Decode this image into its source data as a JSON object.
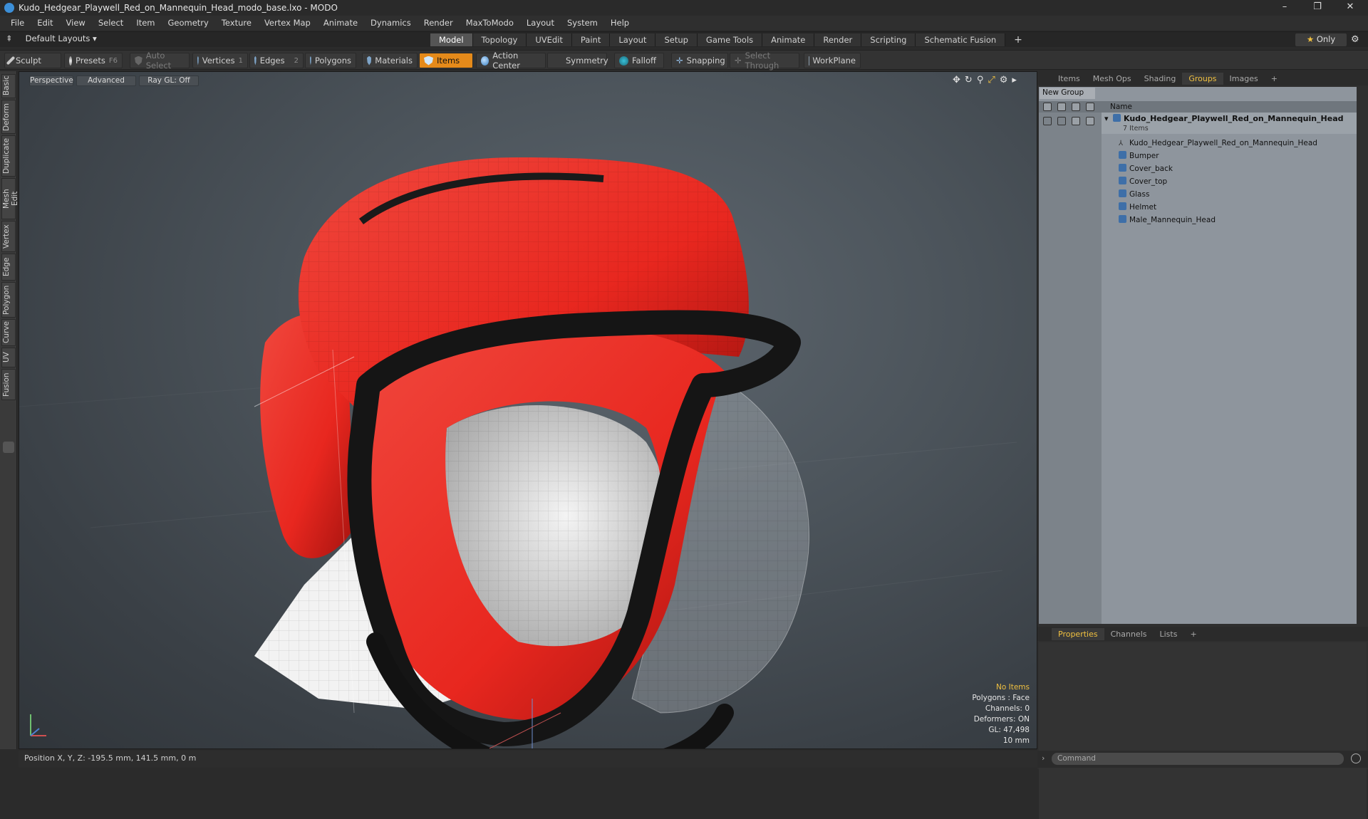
{
  "window": {
    "title": "Kudo_Hedgear_Playwell_Red_on_Mannequin_Head_modo_base.lxo - MODO",
    "controls": [
      "–",
      "❐",
      "✕"
    ]
  },
  "menu": [
    "File",
    "Edit",
    "View",
    "Select",
    "Item",
    "Geometry",
    "Texture",
    "Vertex Map",
    "Animate",
    "Dynamics",
    "Render",
    "MaxToModo",
    "Layout",
    "System",
    "Help"
  ],
  "layout": {
    "selector": "Default Layouts ▾",
    "tabs": [
      "Model",
      "Topology",
      "UVEdit",
      "Paint",
      "Layout",
      "Setup",
      "Game Tools",
      "Animate",
      "Render",
      "Scripting",
      "Schematic Fusion"
    ],
    "active_tab": "Model",
    "add": "+",
    "only_label": "Only",
    "only_star": "★"
  },
  "toolbar": {
    "sculpt": "Sculpt",
    "presets": "Presets",
    "presets_key": "F6",
    "auto_select": "Auto Select",
    "vertices": "Vertices",
    "vertices_count": "1",
    "edges": "Edges",
    "edges_count": "2",
    "polygons": "Polygons",
    "materials": "Materials",
    "items": "Items",
    "action_center": "Action Center",
    "symmetry": "Symmetry",
    "falloff": "Falloff",
    "snapping": "Snapping",
    "select_through": "Select Through",
    "workplane": "WorkPlane"
  },
  "left_tabs": [
    "Basic",
    "Deform",
    "Duplicate",
    "Mesh Edit",
    "Vertex",
    "Edge",
    "Polygon",
    "Curve",
    "UV",
    "Fusion"
  ],
  "viewport": {
    "view": "Perspective",
    "shading": "Advanced",
    "raygl": "Ray GL: Off",
    "stats": {
      "no_items": "No Items",
      "polygons": "Polygons : Face",
      "channels": "Channels: 0",
      "deformers": "Deformers: ON",
      "gl": "GL: 47,498",
      "unit": "10 mm"
    }
  },
  "status": {
    "position": "Position X, Y, Z:  -195.5 mm, 141.5 mm, 0 m"
  },
  "right_panel": {
    "tabs": [
      "Items",
      "Mesh Ops",
      "Shading",
      "Groups",
      "Images"
    ],
    "active_tab": "Groups",
    "new_group": "New Group",
    "col_name": "Name",
    "group_name": "Kudo_Hedgear_Playwell_Red_on_Mannequin_Head",
    "group_sub": "7 Items",
    "items": [
      "Kudo_Hedgear_Playwell_Red_on_Mannequin_Head",
      "Bumper",
      "Cover_back",
      "Cover_top",
      "Glass",
      "Helmet",
      "Male_Mannequin_Head"
    ],
    "prop_tabs": [
      "Properties",
      "Channels",
      "Lists"
    ],
    "prop_active": "Properties",
    "command_placeholder": "Command"
  },
  "colors": {
    "accent": "#e58a1a",
    "helmet_red": "#e8271f",
    "trim_black": "#141414",
    "active_tab_yellow": "#f0c040"
  }
}
